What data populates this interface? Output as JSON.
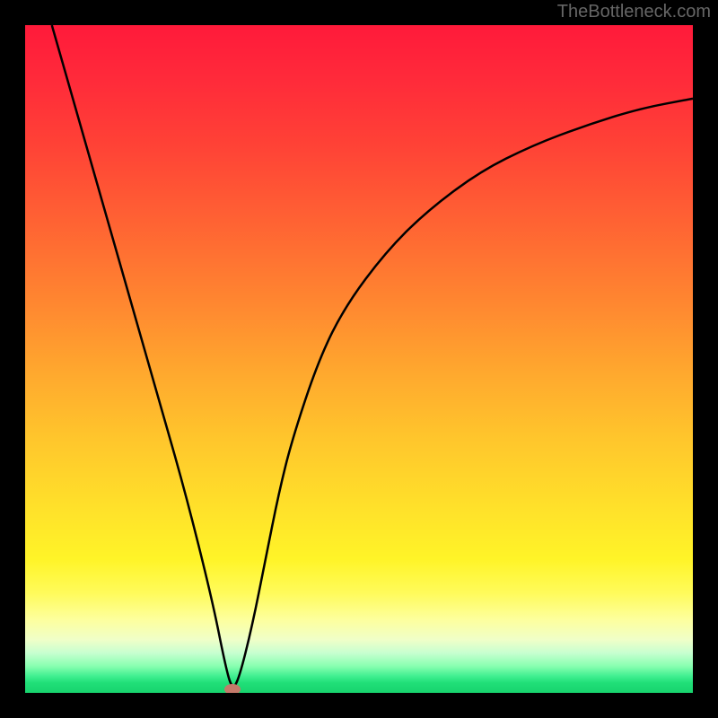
{
  "attribution": "TheBottleneck.com",
  "colors": {
    "frame": "#000000",
    "gradient_top": "#ff1a3a",
    "gradient_mid": "#ffc62c",
    "gradient_bottom": "#18d46e",
    "curve": "#000000",
    "marker": "#c47a6a"
  },
  "chart_data": {
    "type": "line",
    "title": "",
    "xlabel": "",
    "ylabel": "",
    "xlim": [
      0,
      100
    ],
    "ylim": [
      0,
      100
    ],
    "series": [
      {
        "name": "bottleneck-curve",
        "x": [
          4,
          8,
          12,
          16,
          20,
          24,
          28,
          30,
          31,
          32,
          34,
          36,
          38,
          40,
          44,
          48,
          54,
          60,
          68,
          76,
          84,
          92,
          100
        ],
        "y": [
          100,
          86,
          72,
          58,
          44,
          30,
          14,
          4,
          0.5,
          2,
          10,
          20,
          30,
          38,
          50,
          58,
          66,
          72,
          78,
          82,
          85,
          87.5,
          89
        ]
      }
    ],
    "marker_point": {
      "x": 31,
      "y": 0.5
    },
    "annotations": []
  }
}
